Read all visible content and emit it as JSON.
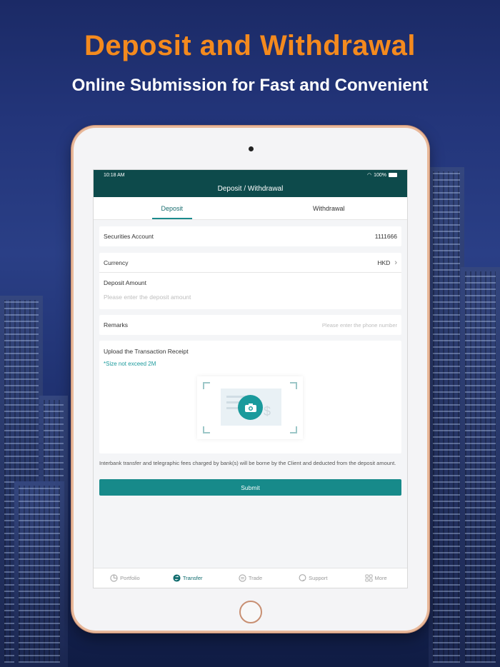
{
  "promo": {
    "headline": "Deposit and Withdrawal",
    "subline": "Online Submission for Fast and Convenient"
  },
  "status": {
    "time": "10:18 AM",
    "battery": "100%"
  },
  "header": {
    "title": "Deposit / Withdrawal"
  },
  "tabs": [
    {
      "label": "Deposit",
      "active": true
    },
    {
      "label": "Withdrawal",
      "active": false
    }
  ],
  "account": {
    "label": "Securities Account",
    "value": "1111666"
  },
  "currency": {
    "label": "Currency",
    "value": "HKD"
  },
  "amount": {
    "label": "Deposit Amount",
    "placeholder": "Please enter the deposit amount"
  },
  "remarks": {
    "label": "Remarks",
    "placeholder": "Please enter the phone number"
  },
  "upload": {
    "title": "Upload the Transaction Receipt",
    "hint": "*Size not exceed 2M"
  },
  "notice": "Interbank transfer and telegraphic fees charged by bank(s) will be borne by the Client and deducted from the deposit amount.",
  "submit_label": "Submit",
  "nav": [
    {
      "label": "Portfolio",
      "icon": "pie-chart-icon",
      "active": false
    },
    {
      "label": "Transfer",
      "icon": "transfer-icon",
      "active": true
    },
    {
      "label": "Trade",
      "icon": "trade-icon",
      "active": false
    },
    {
      "label": "Support",
      "icon": "support-icon",
      "active": false
    },
    {
      "label": "More",
      "icon": "grid-icon",
      "active": false
    }
  ],
  "colors": {
    "accent": "#178a8a",
    "header": "#0d4a4b",
    "headline": "#f48a1e"
  }
}
